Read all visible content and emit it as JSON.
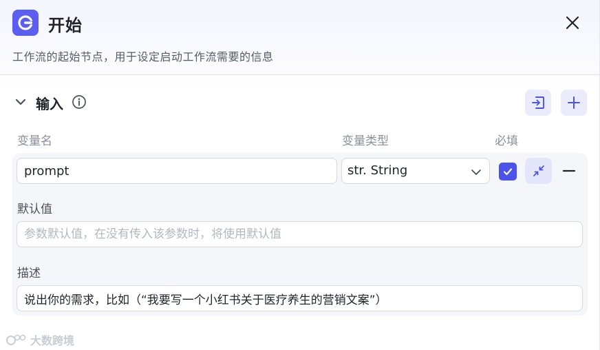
{
  "header": {
    "title": "开始",
    "subtitle": "工作流的起始节点，用于设定启动工作流需要的信息",
    "app_icon": "start-node-icon",
    "close_icon": "close-icon"
  },
  "inputs_section": {
    "title": "输入",
    "columns": {
      "name": "变量名",
      "type": "变量类型",
      "required": "必填"
    },
    "variable": {
      "name_value": "prompt",
      "type_value": "str. String",
      "required_checked": true,
      "default_label": "默认值",
      "default_value": "",
      "default_placeholder": "参数默认值，在没有传入该参数时，将使用默认值",
      "desc_label": "描述",
      "desc_value": "说出你的需求，比如（“我要写一个小红书关于医疗养生的营销文案”）"
    }
  },
  "watermark": {
    "text": "大数跨境"
  },
  "colors": {
    "accent": "#4d53e8",
    "app_icon_bg": "#5b5ef0",
    "button_bg": "#eaecfb"
  }
}
